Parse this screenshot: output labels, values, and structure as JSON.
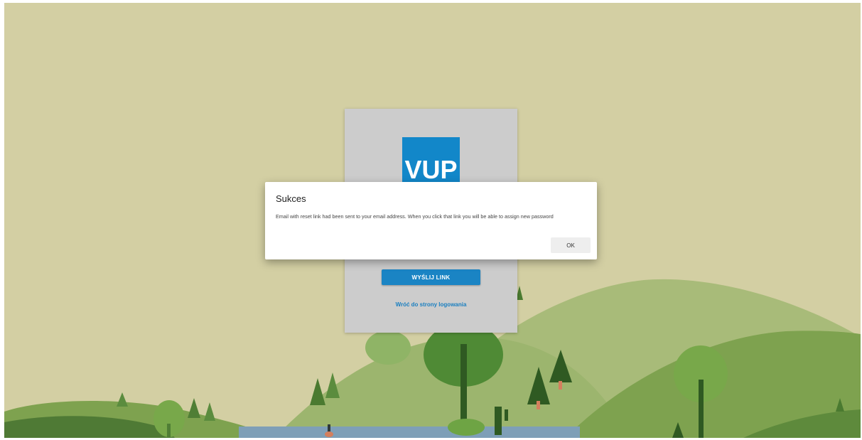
{
  "logo": {
    "text": "VUP"
  },
  "reset_form": {
    "send_button_label": "WYŚLIJ LINK",
    "back_link_label": "Wróć do strony logowania"
  },
  "dialog": {
    "title": "Sukces",
    "message": "Email with reset link had been sent to your email address. When you click that link you will be able to assign new password",
    "ok_label": "OK"
  },
  "colors": {
    "background": "#d3cfa3",
    "brand_blue": "#1287c9",
    "button_blue": "#1a84c4",
    "card_gray": "#cccccc"
  }
}
